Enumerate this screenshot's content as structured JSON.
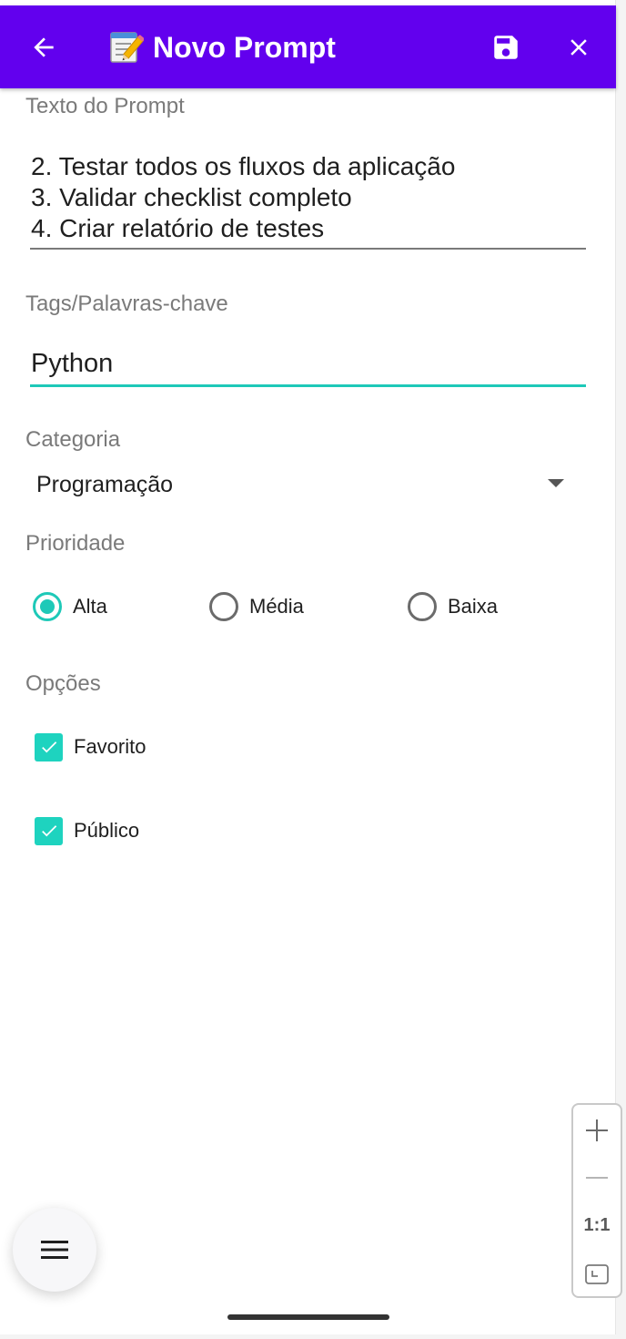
{
  "app_bar": {
    "title_emoji_icon": "memo-icon",
    "title": "Novo Prompt",
    "back_icon": "arrow-left-icon",
    "save_icon": "floppy-disk-icon",
    "close_icon": "close-icon",
    "background": "#6200ee"
  },
  "prompt_field": {
    "label": "Texto do Prompt",
    "lines": [
      "2. Testar todos os fluxos da aplicação",
      "3. Validar checklist completo",
      "4. Criar relatório de testes"
    ]
  },
  "tags_field": {
    "label": "Tags/Palavras-chave",
    "value": "Python",
    "focused_color": "#1ec9b8"
  },
  "category": {
    "label": "Categoria",
    "selected": "Programação",
    "dropdown_icon": "caret-down-icon"
  },
  "priority": {
    "label": "Prioridade",
    "options": [
      "Alta",
      "Média",
      "Baixa"
    ],
    "selected": "Alta"
  },
  "options": {
    "label": "Opções",
    "checkboxes": [
      {
        "label": "Favorito",
        "checked": true
      },
      {
        "label": "Público",
        "checked": true
      }
    ],
    "accent_color": "#1ed3bf"
  },
  "menu_button_icon": "hamburger-menu-icon",
  "zoom_control": {
    "zoom_in_icon": "plus-icon",
    "zoom_out_icon": "minus-icon",
    "reset_label": "1:1",
    "fit_icon": "fit-screen-icon"
  }
}
